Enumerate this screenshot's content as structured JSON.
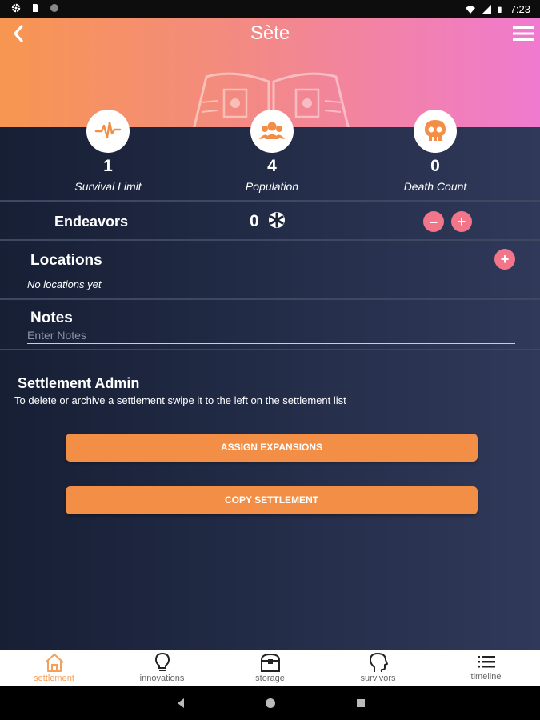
{
  "status_bar": {
    "time": "7:23"
  },
  "header": {
    "title": "Sète"
  },
  "stats": [
    {
      "icon": "heartbeat-icon",
      "value": "1",
      "label": "Survival Limit"
    },
    {
      "icon": "people-icon",
      "value": "4",
      "label": "Population"
    },
    {
      "icon": "skull-icon",
      "value": "0",
      "label": "Death Count"
    }
  ],
  "endeavors": {
    "label": "Endeavors",
    "value": "0"
  },
  "locations": {
    "title": "Locations",
    "empty_text": "No locations yet"
  },
  "notes": {
    "title": "Notes",
    "placeholder": "Enter Notes",
    "value": ""
  },
  "admin": {
    "title": "Settlement Admin",
    "description": "To delete or archive a settlement swipe it to the left on the settlement list",
    "assign_label": "ASSIGN EXPANSIONS",
    "copy_label": "COPY SETTLEMENT"
  },
  "bottom_nav": [
    {
      "label": "settlement",
      "icon": "home-icon",
      "active": true
    },
    {
      "label": "innovations",
      "icon": "lightbulb-icon",
      "active": false
    },
    {
      "label": "storage",
      "icon": "chest-icon",
      "active": false
    },
    {
      "label": "survivors",
      "icon": "head-icon",
      "active": false
    },
    {
      "label": "timeline",
      "icon": "list-icon",
      "active": false
    }
  ],
  "colors": {
    "accent_orange": "#f28e45",
    "accent_pink": "#f2758a",
    "header_gradient_start": "#f79650",
    "header_gradient_end": "#f07ad0",
    "background": "#1c2439"
  }
}
